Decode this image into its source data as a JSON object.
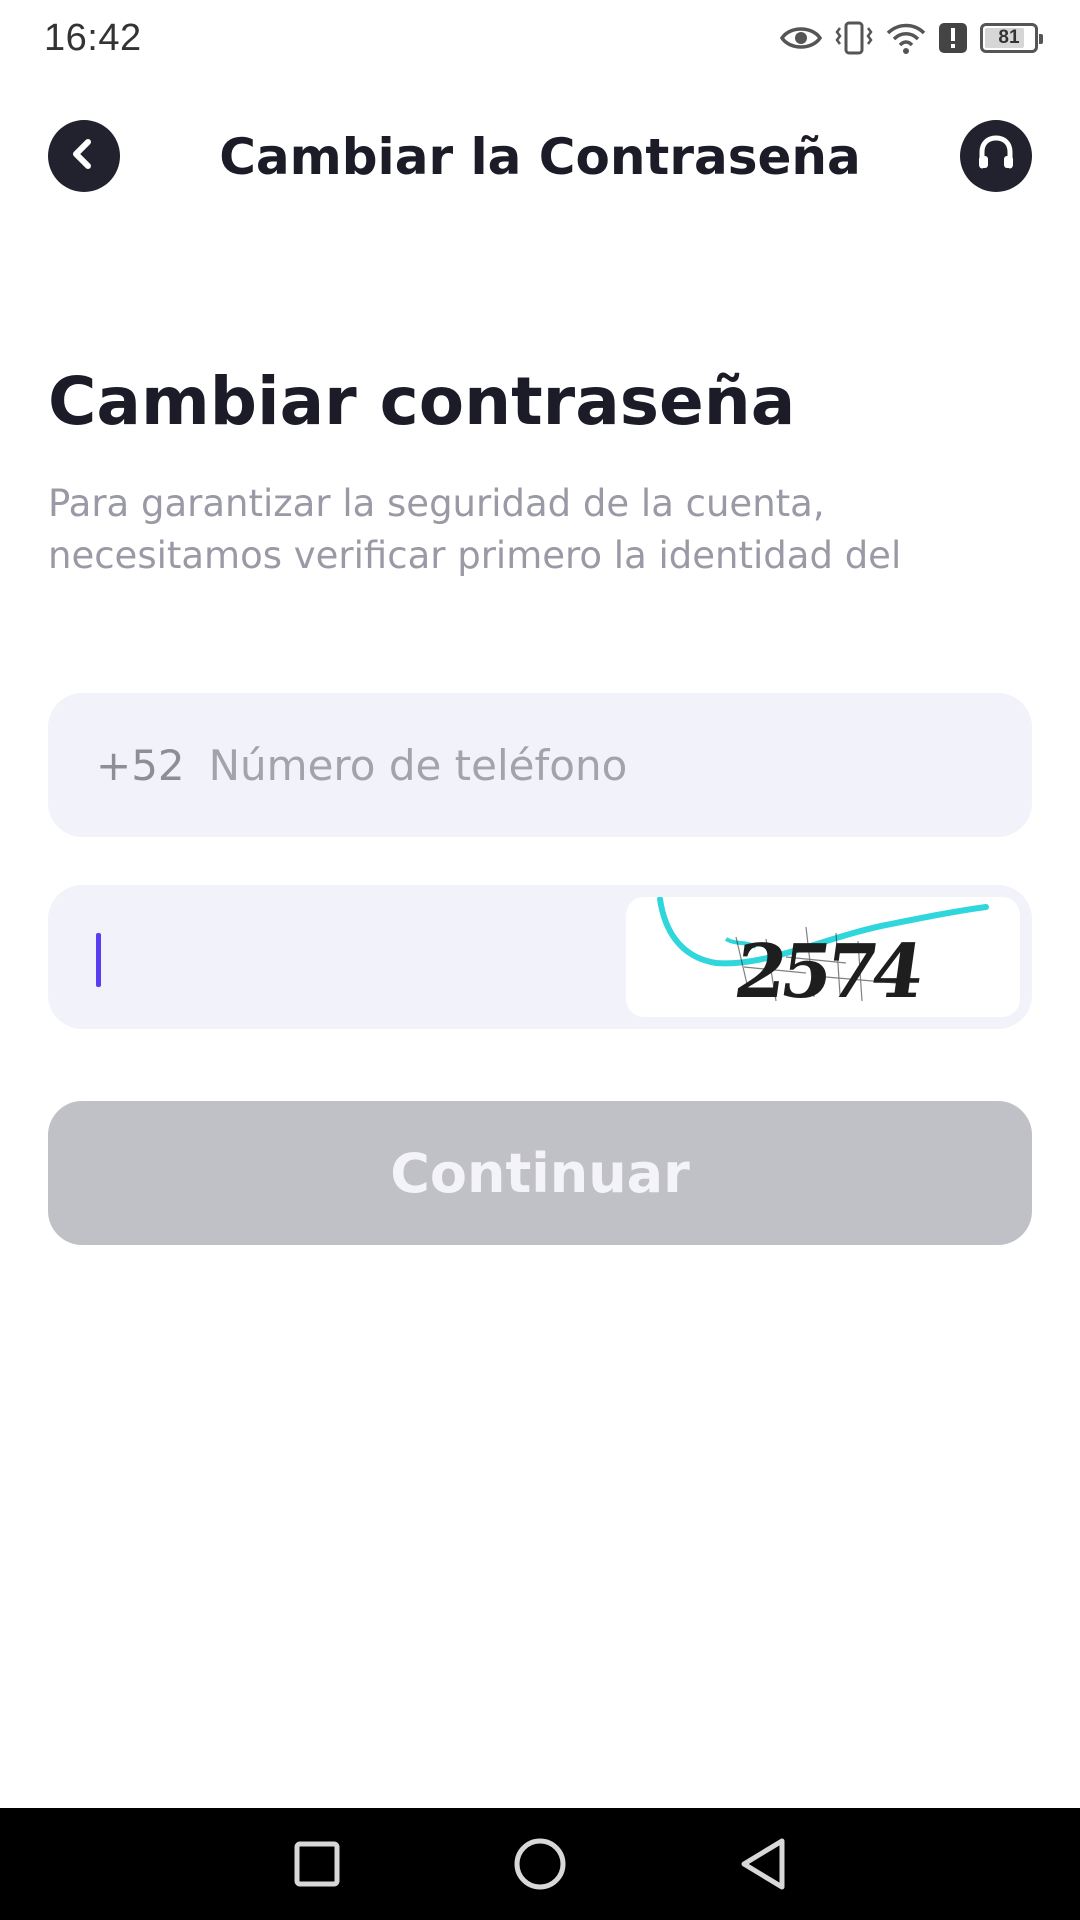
{
  "status_bar": {
    "time": "16:42",
    "battery": "81",
    "battery_fraction": 0.81,
    "icons": [
      "eye-icon",
      "vibrate-icon",
      "wifi-icon",
      "alert-icon",
      "battery-icon"
    ]
  },
  "header": {
    "title": "Cambiar la Contraseña",
    "back_icon": "chevron-left-icon",
    "support_icon": "headset-icon"
  },
  "main": {
    "heading": "Cambiar contraseña",
    "description": "Para garantizar la seguridad de la cuenta, necesitamos verificar primero la identidad del",
    "phone": {
      "country_code": "+52",
      "placeholder": "Número de teléfono",
      "value": ""
    },
    "captcha": {
      "value": "",
      "image_text": "2574"
    },
    "continue_label": "Continuar"
  },
  "nav_bar": {
    "icons": [
      "recents-square-icon",
      "home-circle-icon",
      "back-triangle-icon"
    ]
  },
  "colors": {
    "accent": "#5a3df0",
    "dark": "#22222e",
    "field_bg": "#f2f2fb",
    "button_disabled": "#c0c0c7"
  }
}
